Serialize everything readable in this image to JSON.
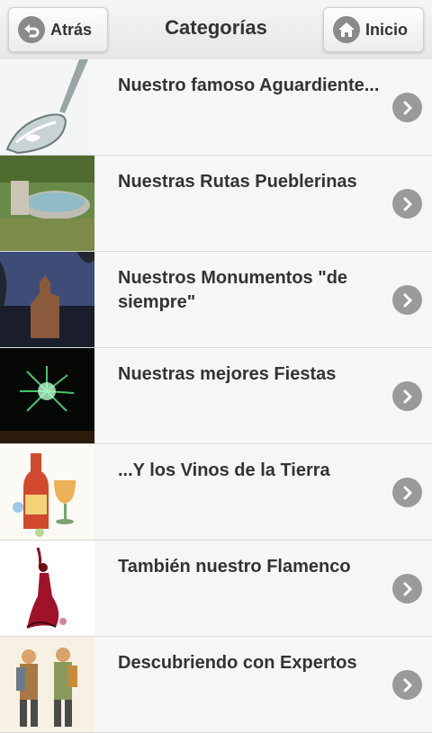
{
  "header": {
    "back_label": "Atrás",
    "title": "Categorías",
    "home_label": "Inicio"
  },
  "categories": [
    {
      "title": "Nuestro famoso Aguardiente...",
      "image": "glass-of-aguardiente-photo"
    },
    {
      "title": "Nuestras Rutas Pueblerinas",
      "image": "stone-fountain-photo"
    },
    {
      "title": "Nuestros Monumentos \"de siempre\"",
      "image": "church-at-dusk-photo"
    },
    {
      "title": "Nuestras mejores Fiestas",
      "image": "fireworks-photo"
    },
    {
      "title": "...Y los Vinos de la Tierra",
      "image": "wine-bottle-watercolor"
    },
    {
      "title": "También nuestro Flamenco",
      "image": "flamenco-dancer-illustration"
    },
    {
      "title": "Descubriendo con Expertos",
      "image": "hikers-illustration"
    }
  ],
  "icons": {
    "back": "back-arrow-icon",
    "home": "house-icon",
    "row_chevron": "chevron-right-icon"
  }
}
